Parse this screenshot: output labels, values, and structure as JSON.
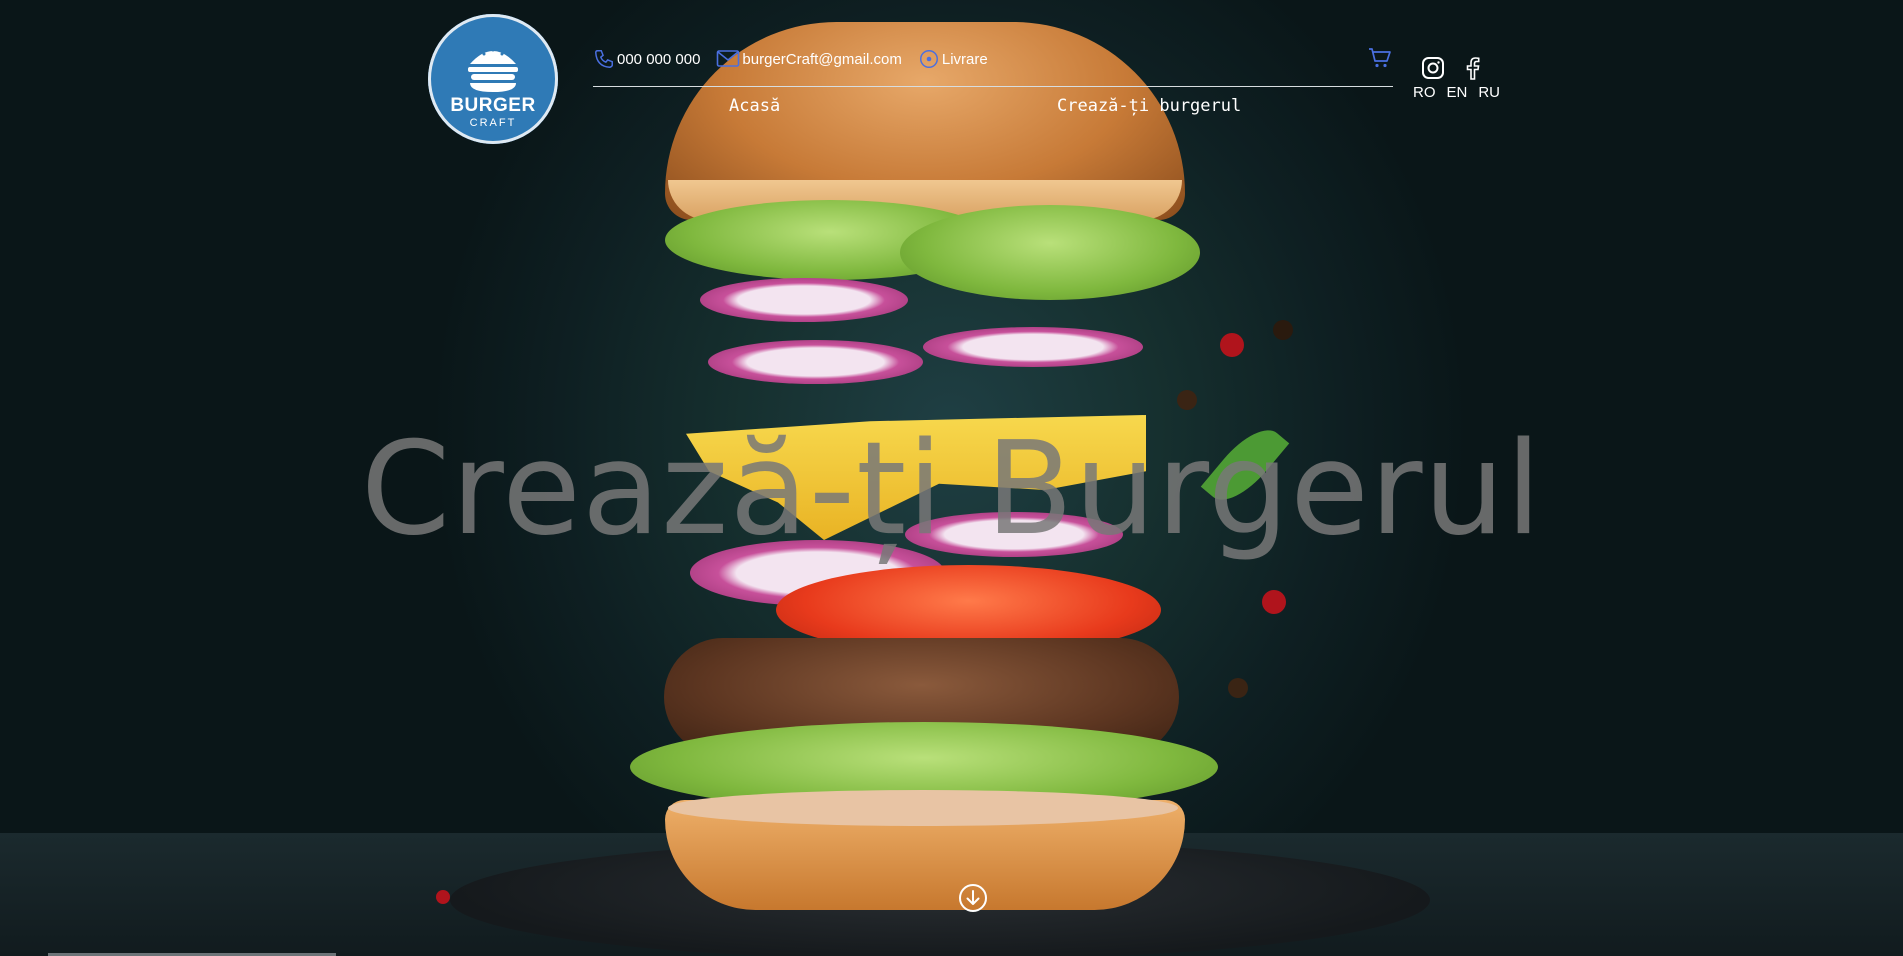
{
  "brand": {
    "title": "BURGER",
    "subtitle": "CRAFT"
  },
  "contacts": {
    "phone": "000 000 000",
    "email": "burgerCraft@gmail.com",
    "delivery": "Livrare"
  },
  "nav": {
    "home": "Acasă",
    "build": "Crează-ți burgerul"
  },
  "languages": [
    "RO",
    "EN",
    "RU"
  ],
  "hero": {
    "title": "Crează-ți Burgerul"
  },
  "icons": {
    "phone": "phone-icon",
    "email": "mail-icon",
    "delivery": "location-icon",
    "cart": "cart-icon",
    "instagram": "instagram-icon",
    "facebook": "facebook-icon",
    "scroll": "arrow-down-circle-icon"
  },
  "colors": {
    "accent": "#4a6fe0",
    "logo": "#2f7ab6"
  }
}
